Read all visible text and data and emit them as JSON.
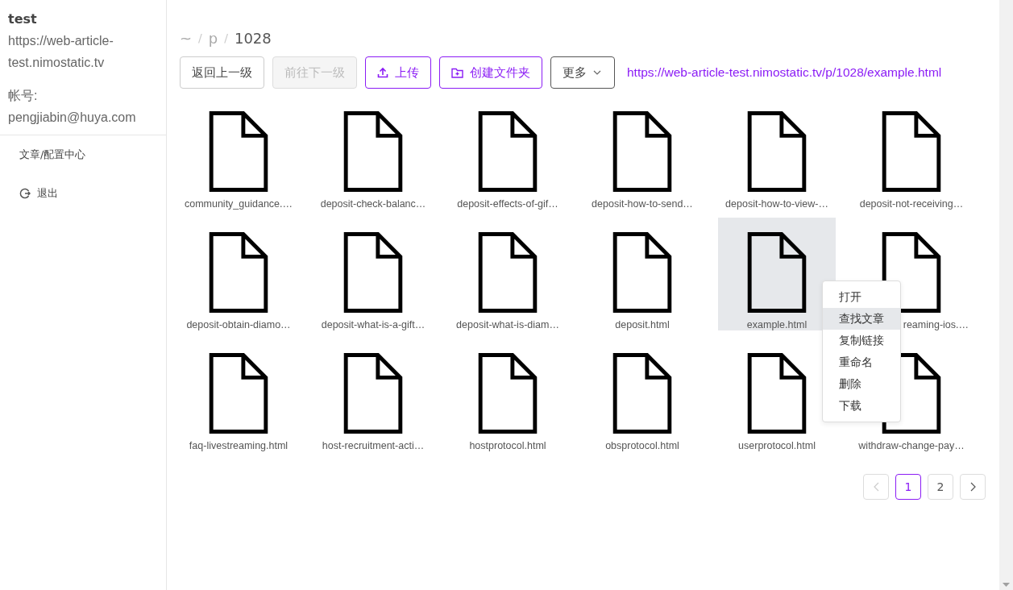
{
  "sidebar": {
    "name": "test",
    "site": "https://web-article-test.nimostatic.tv",
    "account_label": "帐号:",
    "account": "pengjiabin@huya.com",
    "items": [
      {
        "label": "文章/配置中心",
        "kind": "plain"
      },
      {
        "label": "退出",
        "kind": "logout"
      }
    ]
  },
  "breadcrumb": [
    {
      "label": "~",
      "kind": "item"
    },
    {
      "label": "/",
      "kind": "separator"
    },
    {
      "label": "p",
      "kind": "item"
    },
    {
      "label": "/",
      "kind": "separator"
    },
    {
      "label": "1028",
      "kind": "item"
    }
  ],
  "toolbar": [
    {
      "label": "返回上一级",
      "kind": "plain",
      "disabled": false
    },
    {
      "label": "前往下一级",
      "kind": "plain",
      "disabled": true
    },
    {
      "label": "上传",
      "kind": "upload",
      "disabled": false
    },
    {
      "label": "创建文件夹",
      "kind": "folder",
      "disabled": false
    },
    {
      "label": "更多",
      "kind": "dropdown",
      "disabled": false
    }
  ],
  "current_url": "https://web-article-test.nimostatic.tv/p/1028/example.html",
  "files": [
    {
      "name": "community_guidance.…",
      "selected": false
    },
    {
      "name": "deposit-check-balanc…",
      "selected": false
    },
    {
      "name": "deposit-effects-of-gif…",
      "selected": false
    },
    {
      "name": "deposit-how-to-send…",
      "selected": false
    },
    {
      "name": "deposit-how-to-view-…",
      "selected": false
    },
    {
      "name": "deposit-not-receiving…",
      "selected": false
    },
    {
      "name": "deposit-obtain-diamo…",
      "selected": false
    },
    {
      "name": "deposit-what-is-a-gift…",
      "selected": false
    },
    {
      "name": "deposit-what-is-diam…",
      "selected": false
    },
    {
      "name": "deposit.html",
      "selected": false
    },
    {
      "name": "example.html",
      "selected": true
    },
    {
      "name": "reaming-ios.…",
      "selected": false,
      "covered": true
    },
    {
      "name": "faq-livestreaming.html",
      "selected": false
    },
    {
      "name": "host-recruitment-acti…",
      "selected": false
    },
    {
      "name": "hostprotocol.html",
      "selected": false
    },
    {
      "name": "obsprotocol.html",
      "selected": false
    },
    {
      "name": "userprotocol.html",
      "selected": false
    },
    {
      "name": "withdraw-change-pay…",
      "selected": false
    }
  ],
  "context_menu": [
    {
      "label": "打开",
      "selected": false
    },
    {
      "label": "查找文章",
      "selected": true
    },
    {
      "label": "复制链接",
      "selected": false
    },
    {
      "label": "重命名",
      "selected": false
    },
    {
      "label": "删除",
      "selected": false
    },
    {
      "label": "下载",
      "selected": false
    }
  ],
  "pagination": {
    "prev_disabled": true,
    "pages": [
      {
        "label": "1",
        "selected": true
      },
      {
        "label": "2",
        "selected": false
      }
    ],
    "next_disabled": false
  }
}
